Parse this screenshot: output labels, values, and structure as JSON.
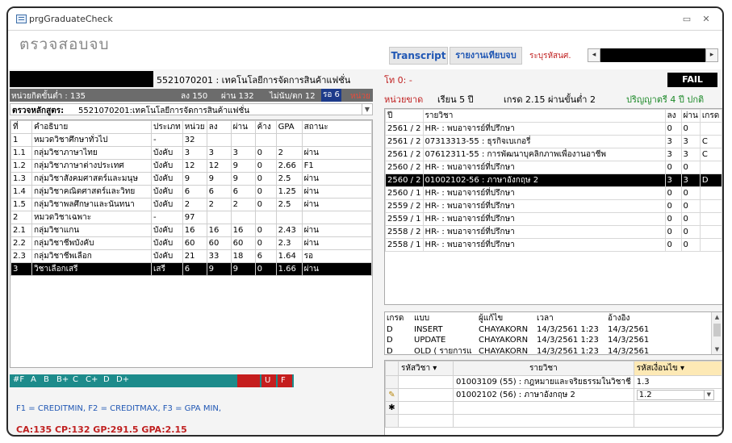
{
  "window": {
    "title": "prgGraduateCheck"
  },
  "form": {
    "title": "ตรวจสอบจบ"
  },
  "toolbar": {
    "transcript_label": "Transcript",
    "report_label": "รายงานเทียบจบ",
    "student_id_label": "ระบุรหัสนศ.",
    "prev_label": "◂",
    "next_label": "▸"
  },
  "program": {
    "label": "5521070201 : เทคโนโลยีการจัดการสินค้าแฟชั่น"
  },
  "credits": {
    "min": "หน่วยกิตขั้นต่ำ : 135",
    "registered": "ลง 150",
    "passed": "ผ่าน 132",
    "not_counted": "ไม่นับ/ตก 12",
    "pending": "รอ 6",
    "unit": "หน่วย"
  },
  "curriculum": {
    "label": "ตรวจหลักสูตร:",
    "value": "5521070201:เทคโนโลยีการจัดการสินค้าแฟชั่น",
    "dropdown_icon": "chevron-down"
  },
  "left_table": {
    "headers": [
      "ที่",
      "คำอธิบาย",
      "ประเภท",
      "หน่วย",
      "ลง",
      "ผ่าน",
      "ค้าง",
      "GPA",
      "สถานะ"
    ],
    "rows": [
      [
        "1",
        "หมวดวิชาศึกษาทั่วไป",
        "-",
        "32",
        "",
        "",
        "",
        "",
        ""
      ],
      [
        "1.1",
        "กลุ่มวิชาภาษาไทย",
        "บังคับ",
        "3",
        "3",
        "3",
        "0",
        "2",
        "ผ่าน"
      ],
      [
        "1.2",
        "กลุ่มวิชาภาษาต่างประเทศ",
        "บังคับ",
        "12",
        "12",
        "9",
        "0",
        "2.66",
        "F1"
      ],
      [
        "1.3",
        "กลุ่มวิชาสังคมศาสตร์และมนุษ",
        "บังคับ",
        "9",
        "9",
        "9",
        "0",
        "2.5",
        "ผ่าน"
      ],
      [
        "1.4",
        "กลุ่มวิชาคณิตศาสตร์และวิทย",
        "บังคับ",
        "6",
        "6",
        "6",
        "0",
        "1.25",
        "ผ่าน"
      ],
      [
        "1.5",
        "กลุ่มวิชาพลศึกษาและนันทนา",
        "บังคับ",
        "2",
        "2",
        "2",
        "0",
        "2.5",
        "ผ่าน"
      ],
      [
        "2",
        "หมวดวิชาเฉพาะ",
        "-",
        "97",
        "",
        "",
        "",
        "",
        ""
      ],
      [
        "2.1",
        "กลุ่มวิชาแกน",
        "บังคับ",
        "16",
        "16",
        "16",
        "0",
        "2.43",
        "ผ่าน"
      ],
      [
        "2.2",
        "กลุ่มวิชาชีพบังคับ",
        "บังคับ",
        "60",
        "60",
        "60",
        "0",
        "2.3",
        "ผ่าน"
      ],
      [
        "2.3",
        "กลุ่มวิชาชีพเลือก",
        "บังคับ",
        "21",
        "33",
        "18",
        "6",
        "1.64",
        "รอ"
      ],
      [
        "3",
        "วิชาเลือกเสรี",
        "เสรี",
        "6",
        "9",
        "9",
        "0",
        "1.66",
        "ผ่าน"
      ]
    ],
    "selected_row": 10
  },
  "grade_bar": {
    "items": [
      "#F",
      "A",
      "B",
      "B+",
      "C",
      "C+",
      "D",
      "D+",
      "U",
      "F"
    ],
    "teal": "#1d8b8b",
    "red": "#c51e1e"
  },
  "legend": {
    "text": "F1 = CREDITMIN, F2 = CREDITMAX, F3 = GPA MIN,"
  },
  "totals": {
    "text": "CA:135 CP:132 GP:291.5 GPA:2.15"
  },
  "right": {
    "t_label": "โท 0: -",
    "status": "FAIL",
    "missing_label": "หน่วยขาด",
    "study_years": "เรียน 5 ปี",
    "grade_info": "เกรด 2.15 ผ่านขั้นต่ำ 2",
    "degree_info": "ปริญญาตรี 4 ปี ปกติ",
    "table": {
      "headers": [
        "ปี",
        "รายวิชา",
        "ลง",
        "ผ่าน",
        "เกรด"
      ],
      "rows": [
        [
          "2561 / 2",
          "HR- : พบอาจารย์ที่ปรึกษา",
          "0",
          "0",
          ""
        ],
        [
          "2561 / 2",
          "07313313-55 : ธุรกิจเบเกอรี่",
          "3",
          "3",
          "C"
        ],
        [
          "2561 / 2",
          "07612311-55 : การพัฒนาบุคลิกภาพเพื่องานอาชีพ",
          "3",
          "3",
          "C"
        ],
        [
          "2560 / 2",
          "HR- : พบอาจารย์ที่ปรึกษา",
          "0",
          "0",
          ""
        ],
        [
          "2560 / 2",
          "01002102-56 : ภาษาอังกฤษ 2",
          "3",
          "3",
          "D"
        ],
        [
          "2560 / 1",
          "HR- : พบอาจารย์ที่ปรึกษา",
          "0",
          "0",
          ""
        ],
        [
          "2559 / 2",
          "HR- : พบอาจารย์ที่ปรึกษา",
          "0",
          "0",
          ""
        ],
        [
          "2559 / 1",
          "HR- : พบอาจารย์ที่ปรึกษา",
          "0",
          "0",
          ""
        ],
        [
          "2558 / 2",
          "HR- : พบอาจารย์ที่ปรึกษา",
          "0",
          "0",
          ""
        ],
        [
          "2558 / 1",
          "HR- : พบอาจารย์ที่ปรึกษา",
          "0",
          "0",
          ""
        ]
      ],
      "selected_row": 4
    },
    "log": {
      "headers": [
        "เกรด",
        "แบบ",
        "ผู้แก้ไข",
        "เวลา",
        "อ้างอิง"
      ],
      "rows": [
        [
          "D",
          "INSERT",
          "CHAYAKORN",
          "14/3/2561 1:23",
          "14/3/2561"
        ],
        [
          "D",
          "UPDATE",
          "CHAYAKORN",
          "14/3/2561 1:23",
          "14/3/2561"
        ],
        [
          "D",
          "OLD ( รายการแ",
          "CHAYAKORN",
          "14/3/2561 1:23",
          "14/3/2561"
        ]
      ]
    },
    "subform": {
      "headers": [
        "รหัสวิชา",
        "รายวิชา",
        "รหัสเงื่อนไข"
      ],
      "rows": [
        [
          "",
          "01003109 (55) : กฎหมายและจริยธรรมในวิชาชี",
          "1.3"
        ],
        [
          "",
          "01002102 (56) : ภาษาอังกฤษ 2",
          "1.2"
        ]
      ]
    }
  }
}
